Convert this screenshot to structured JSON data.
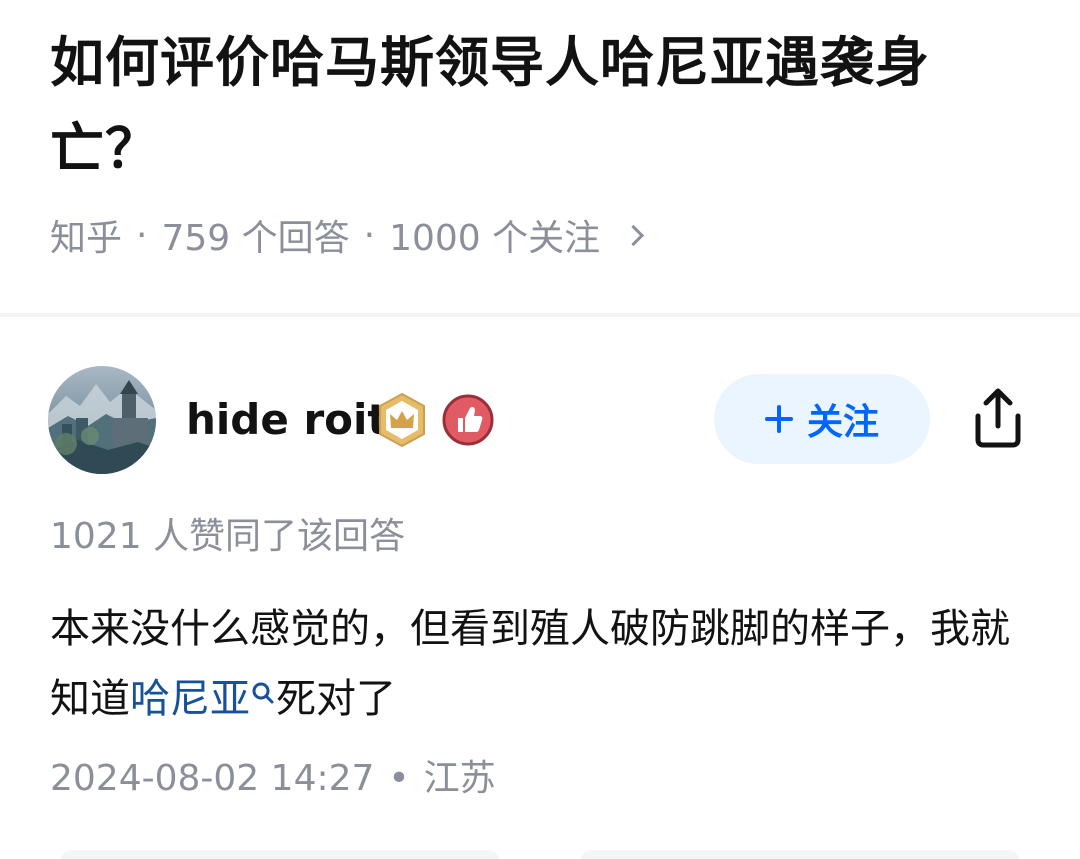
{
  "question": {
    "title": "如何评价哈马斯领导人哈尼亚遇袭身亡？",
    "source": "知乎",
    "answer_count": "759 个回答",
    "follower_count": "1000 个关注",
    "separator": "·"
  },
  "author": {
    "name": "hide roit",
    "avatar": "landscape-castle-avatar",
    "badges": [
      "crown-badge-icon",
      "thumbs-up-badge-icon"
    ],
    "follow_label": "关注",
    "share_icon": "share-icon"
  },
  "answer": {
    "vote_text": "1021 人赞同了该回答",
    "content_before": "本来没什么感觉的，但看到殖人破防跳脚的样子，我就知道",
    "content_link": "哈尼亚",
    "content_after": "死对了",
    "date": "2024-08-02 14:27",
    "dot": "•",
    "location": "江苏"
  },
  "colors": {
    "title": "#121212",
    "meta_gray": "#8a8f99",
    "link_blue": "#175199",
    "follow_bg": "#ebf5ff",
    "follow_text": "#0066ff"
  }
}
